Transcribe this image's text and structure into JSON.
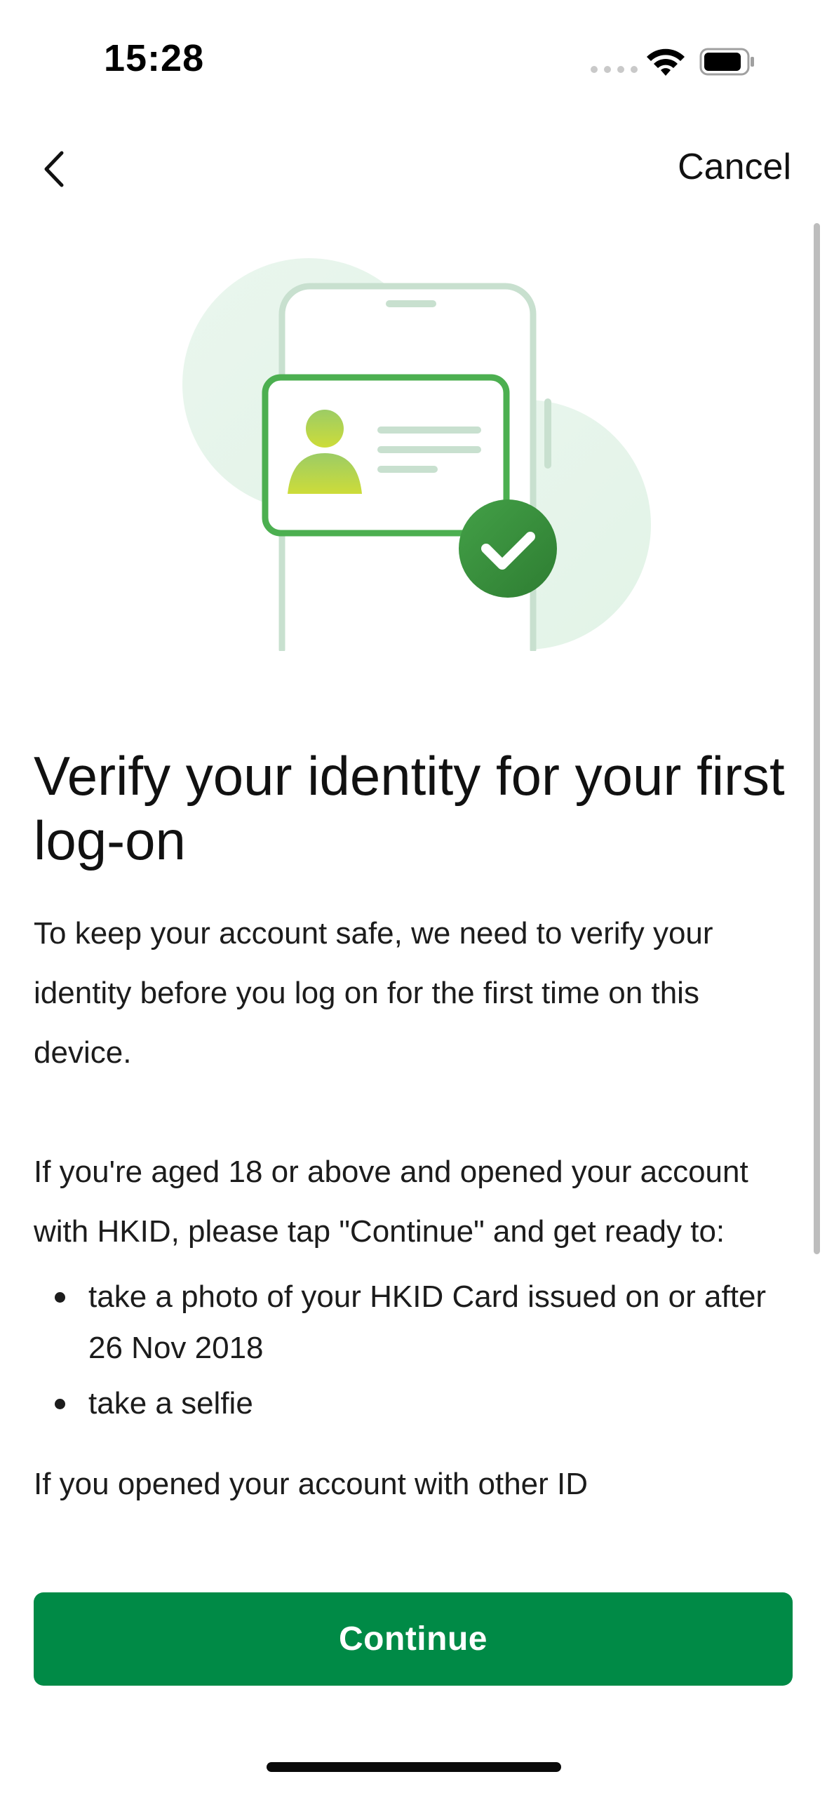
{
  "status_bar": {
    "time": "15:28"
  },
  "nav": {
    "cancel_label": "Cancel",
    "back_icon": "chevron-left-icon"
  },
  "hero": {
    "icon": "id-card-verified-illustration"
  },
  "content": {
    "title": "Verify your identity for your first log-on",
    "intro": "To keep your account safe, we need to verify your identity before you log on for the first time on this device.",
    "hkid_instruction": "If you're aged 18 or above and opened your account with HKID, please tap \"Continue\" and get ready to:",
    "steps": [
      "take a photo of your HKID Card issued on or after 26 Nov 2018",
      "take a selfie"
    ],
    "other_id_partial": "If you opened your account with other ID"
  },
  "actions": {
    "continue_label": "Continue"
  },
  "colors": {
    "primary": "#008a46",
    "illustration_green": "#4caf50",
    "illustration_bg": "#e6f4ea"
  }
}
